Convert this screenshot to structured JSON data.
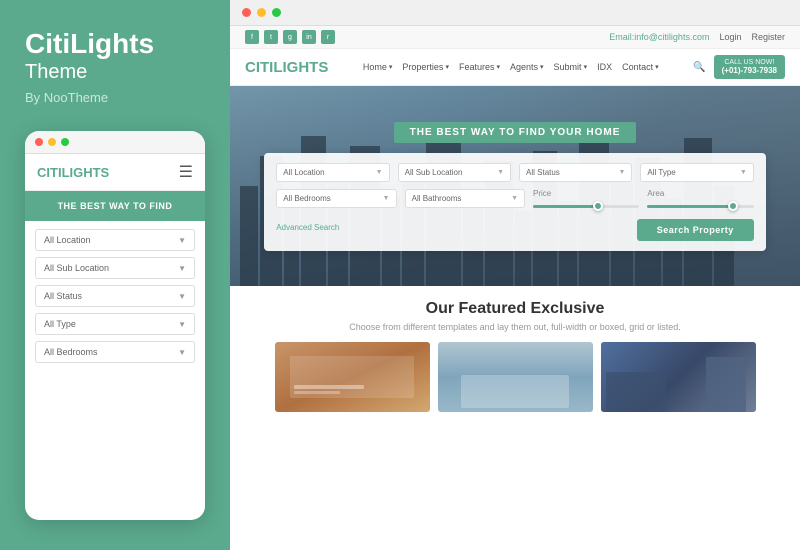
{
  "left": {
    "brand": "CitiLights",
    "theme": "Theme",
    "by": "By NooTheme",
    "mobile": {
      "logo_citi": "CITI",
      "logo_lights": "LIGHTS",
      "hero_text": "THE BEST WAY TO FIND",
      "filters": [
        {
          "label": "All Location",
          "name": "mobile-filter-location"
        },
        {
          "label": "All Sub Location",
          "name": "mobile-filter-sublocation"
        },
        {
          "label": "All Status",
          "name": "mobile-filter-status"
        },
        {
          "label": "All Type",
          "name": "mobile-filter-type"
        },
        {
          "label": "All Bedrooms",
          "name": "mobile-filter-bedrooms"
        }
      ]
    }
  },
  "right": {
    "topbar": {
      "email": "Email:info@citilights.com",
      "login": "Login",
      "register": "Register",
      "social": [
        "f",
        "t",
        "g+",
        "in",
        "rss"
      ]
    },
    "nav": {
      "logo_citi": "CITI",
      "logo_lights": "LIGHTS",
      "links": [
        "Home",
        "Properties",
        "Features",
        "Agents",
        "Submit",
        "IDX",
        "Contact"
      ],
      "call_now": "CALL US NOW!",
      "phone": "(+01)-793-7938"
    },
    "hero": {
      "badge": "THE BEST WAY TO FIND YOUR HOME",
      "filters_row1": [
        {
          "label": "All Location"
        },
        {
          "label": "All Sub Location"
        },
        {
          "label": "All Status"
        },
        {
          "label": "All Type"
        }
      ],
      "filters_row2_left": [
        {
          "label": "All Bedrooms"
        },
        {
          "label": "All Bathrooms"
        }
      ],
      "price_label": "Price",
      "area_label": "Area",
      "advanced_search": "Advanced Search",
      "search_btn": "Search Property"
    },
    "featured": {
      "title": "Our Featured Exclusive",
      "subtitle": "Choose from different templates and lay them out, full-width or boxed, grid or listed."
    }
  }
}
